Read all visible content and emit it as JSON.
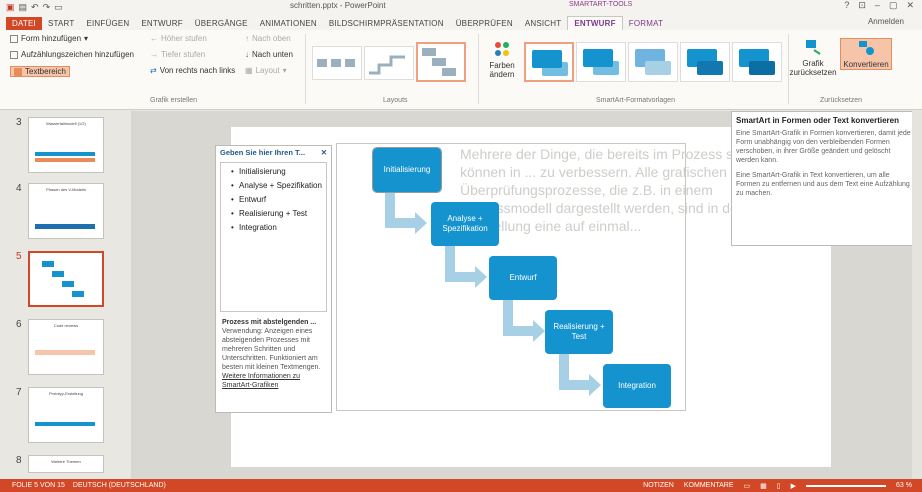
{
  "window": {
    "title": "schritten.pptx - PowerPoint",
    "context_tools": "SMARTART-TOOLS",
    "signin": "Anmelden",
    "controls": [
      "?",
      "⊡",
      "–",
      "▢",
      "✕"
    ]
  },
  "tabs": [
    "DATEI",
    "START",
    "EINFÜGEN",
    "ENTWURF",
    "ÜBERGÄNGE",
    "ANIMATIONEN",
    "BILDSCHIRMPRÄSENTATION",
    "ÜBERPRÜFEN",
    "ANSICHT",
    "ENTWURF",
    "FORMAT"
  ],
  "ribbon": {
    "create": {
      "form_hinzufuegen": "Form hinzufügen",
      "aufzaehlung": "Aufzählungszeichen hinzufügen",
      "textbereich": "Textbereich",
      "hoeher": "Höher stufen",
      "tiefer": "Tiefer stufen",
      "rtl": "Von rechts nach links",
      "layout": "Layout",
      "nach_oben": "Nach oben",
      "nach_unten": "Nach unten",
      "label": "Grafik erstellen"
    },
    "layouts_label": "Layouts",
    "farben": "Farben ändern",
    "styles_label": "SmartArt-Formatvorlagen",
    "reset": {
      "grafik": "Grafik zurücksetzen",
      "konvertieren": "Konvertieren",
      "label": "Zurücksetzen"
    }
  },
  "slides": [
    {
      "num": "3",
      "title": "Wasserfallmodell (1/2)"
    },
    {
      "num": "4",
      "title": "Phasen des V-Modells"
    },
    {
      "num": "5",
      "title": ""
    },
    {
      "num": "6",
      "title": "Code reviews"
    },
    {
      "num": "7",
      "title": "Prototyp-Erstellung"
    },
    {
      "num": "8",
      "title": "Weitere Themen"
    }
  ],
  "textpane": {
    "title": "Geben Sie hier Ihren T...",
    "close": "✕",
    "items": [
      "Initialisierung",
      "Analyse + Spezifikation",
      "Entwurf",
      "Realisierung + Test",
      "Integration"
    ],
    "footer_title": "Prozess mit abstelgenden ...",
    "footer_desc": "Verwendung: Anzeigen eines absteigenden Prozesses mit mehreren Schritten und Unterschritten. Funktioniert am besten mit kleinen Textmengen.",
    "footer_link": "Weitere Informationen zu SmartArt-Grafiken"
  },
  "smartart": {
    "boxes": [
      "Initialisierung",
      "Analyse + Spezifikation",
      "Entwurf",
      "Realisierung + Test",
      "Integration"
    ],
    "color": "#1493cf",
    "arrow_color": "#a7d0e6"
  },
  "ghost_text": "Mehrere der Dinge, die bereits im Prozess sind, können in ... zu verbessern. Alle grafischen Überprüfungsprozesse, die z.B. in einem Prozessmodell dargestellt werden, sind in der Darstellung eine auf einmal...",
  "help": {
    "title": "SmartArt in Formen oder Text konvertieren",
    "p1": "Eine SmartArt-Grafik in Formen konvertieren, damit jede Form unabhängig von den verbleibenden Formen verschoben, in ihrer Größe geändert und gelöscht werden kann.",
    "p2": "Eine SmartArt-Grafik in Text konvertieren, um alle Formen zu entfernen und aus dem Text eine Aufzählung zu machen."
  },
  "status": {
    "folie": "FOLIE 5 VON 15",
    "sprache": "DEUTSCH (DEUTSCHLAND)",
    "notizen": "NOTIZEN",
    "kommentare": "KOMMENTARE",
    "zoom": "63 %"
  },
  "accent": "#d24726"
}
